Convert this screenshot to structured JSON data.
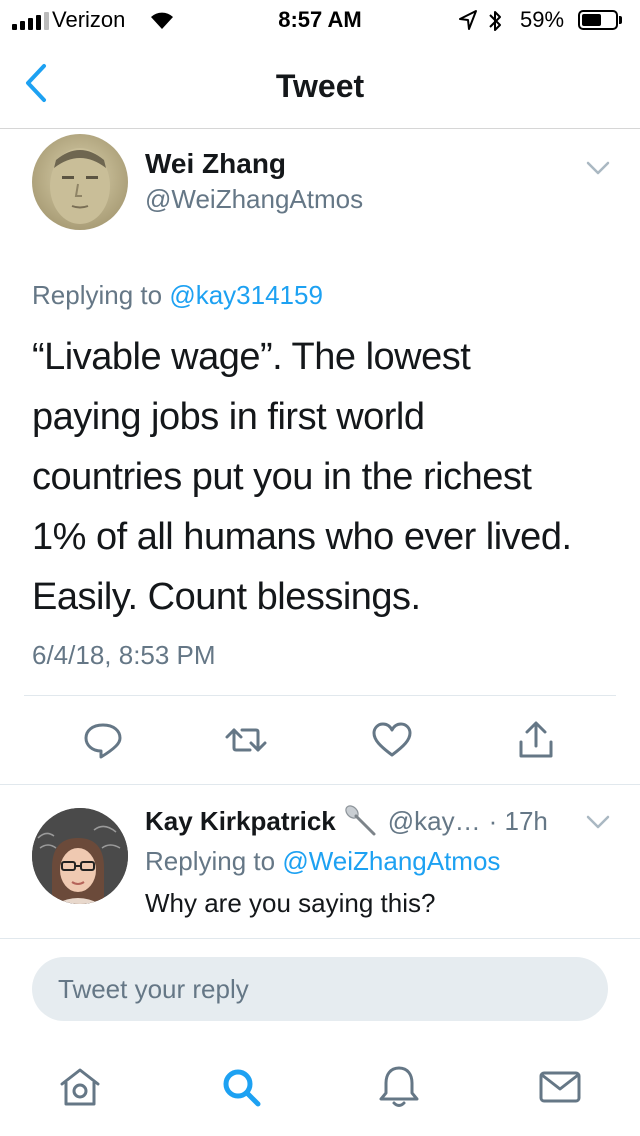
{
  "status_bar": {
    "carrier": "Verizon",
    "time": "8:57 AM",
    "battery": "59%",
    "battery_level": 0.59
  },
  "nav": {
    "title": "Tweet",
    "back_icon": "chevron-left-icon"
  },
  "tweet": {
    "author_name": "Wei Zhang",
    "author_handle": "@WeiZhangAtmos",
    "replying_prefix": "Replying to",
    "replying_handle": "@kay314159",
    "lines": [
      "“Livable wage”. The lowest",
      "paying jobs in first world",
      "countries put you in the richest",
      "1% of all humans who ever lived.",
      "Easily. Count blessings."
    ],
    "date": "6/4/18, 8:53 PM"
  },
  "actions": {
    "icons": [
      "reply-icon",
      "retweet-icon",
      "like-icon",
      "share-icon"
    ]
  },
  "reply": {
    "name": "Kay Kirkpatrick",
    "emoji": "spoon",
    "handle": "@kay…",
    "time": "· 17h",
    "replying_prefix": "Replying to",
    "replying_handle": "@WeiZhangAtmos",
    "text": "Why are you saying this?"
  },
  "composer": {
    "placeholder": "Tweet your reply"
  },
  "tab_bar": {
    "icons": [
      "home-icon",
      "search-icon",
      "notifications-icon",
      "messages-icon"
    ],
    "active": "search-icon"
  },
  "colors": {
    "accent": "#1da1f2",
    "secondary_text": "#657786",
    "primary_text": "#14171a",
    "divider": "#e1e8ed",
    "composer_bg": "#e6ecf0"
  }
}
